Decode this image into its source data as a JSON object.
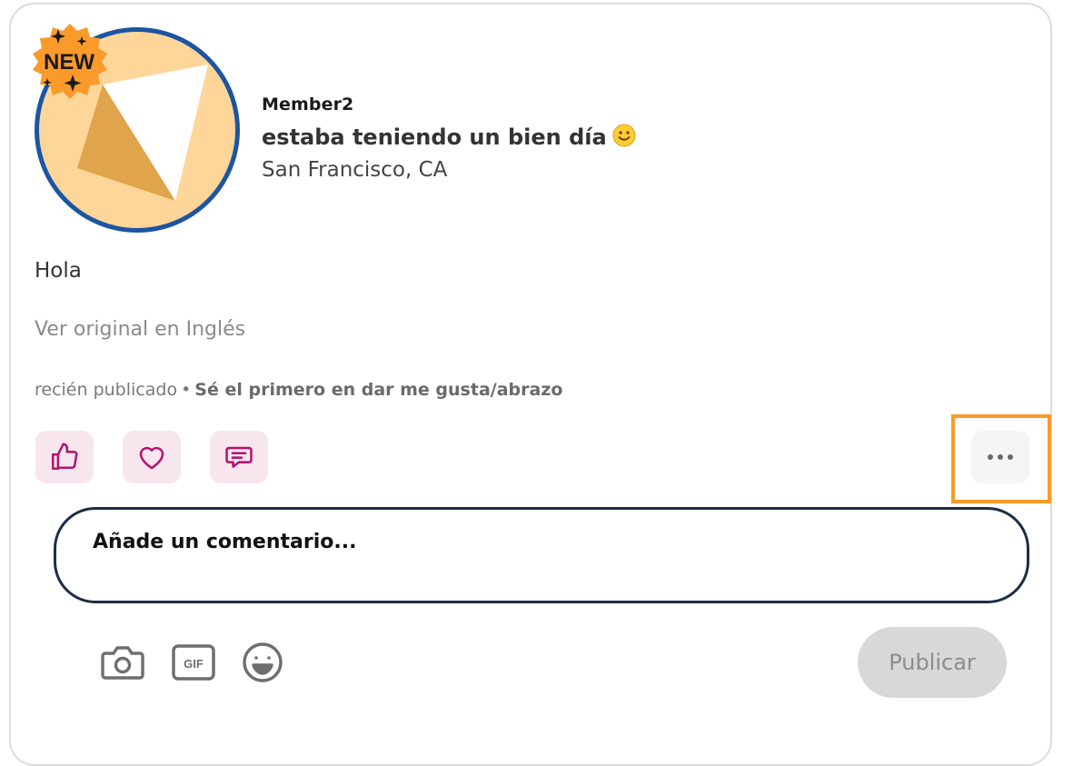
{
  "post": {
    "badge": "NEW",
    "username": "Member2",
    "status": "estaba teniendo un bien día",
    "location": "San Francisco, CA",
    "body": "Hola",
    "see_original": "Ver original en Inglés",
    "timestamp": "recién publicado",
    "separator": "•",
    "first_like_cta": "Sé el primero en dar me gusta/abrazo"
  },
  "actions": {
    "like_icon": "thumbs-up-icon",
    "hug_icon": "heart-icon",
    "comment_icon": "comment-icon",
    "more_icon": "more-dots-icon"
  },
  "composer": {
    "placeholder": "Añade un comentario...",
    "tools": [
      "camera-icon",
      "gif-icon",
      "emoji-icon"
    ],
    "publish_label": "Publicar"
  },
  "colors": {
    "accent": "#b0176f",
    "reaction_bg": "#f8e6ef",
    "avatar_ring": "#1c55a3",
    "badge": "#f99a2a",
    "highlight": "#f99a2a",
    "input_border": "#1e2d44",
    "publish_disabled_bg": "#d8d8d8"
  }
}
